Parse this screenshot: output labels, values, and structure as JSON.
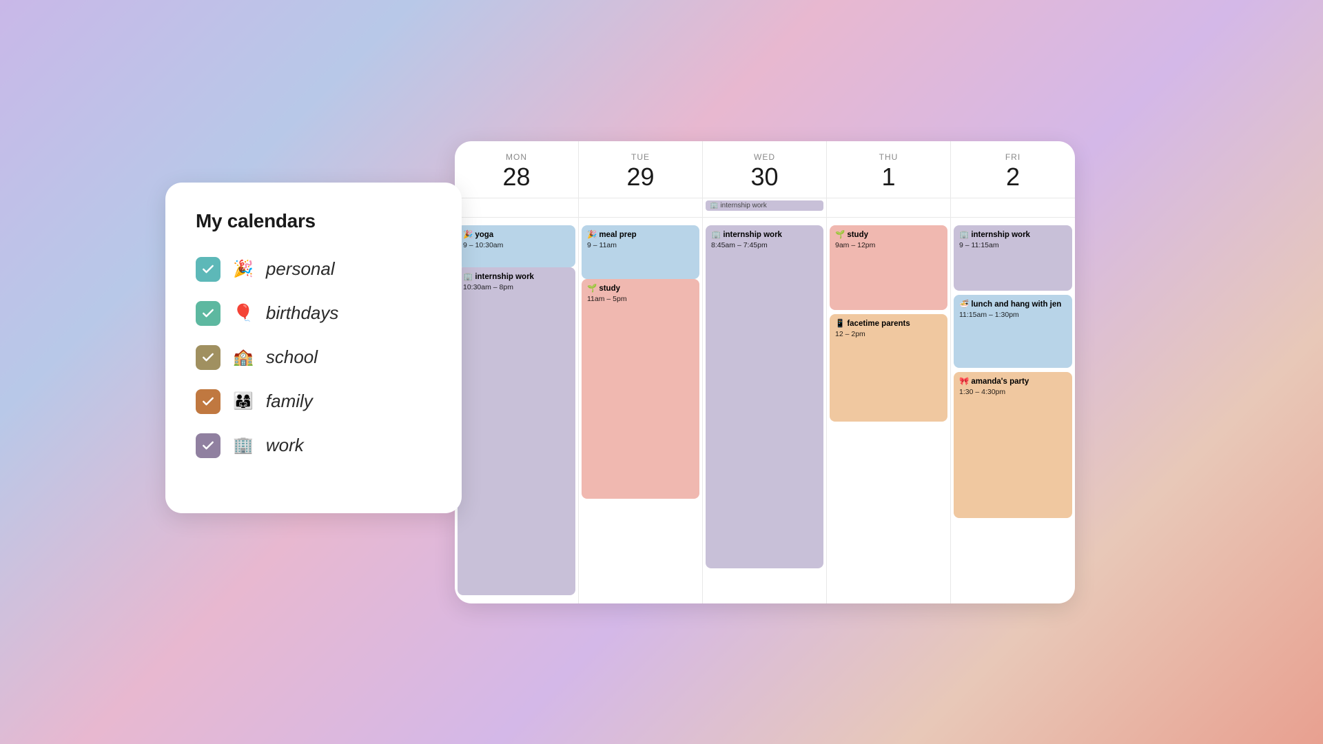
{
  "sidebar": {
    "title": "My calendars",
    "calendars": [
      {
        "id": "personal",
        "emoji": "🎉",
        "label": "personal",
        "color_class": "checkbox-personal",
        "checked": true
      },
      {
        "id": "birthdays",
        "emoji": "🎈",
        "label": "birthdays",
        "color_class": "checkbox-birthdays",
        "checked": true
      },
      {
        "id": "school",
        "emoji": "🏫",
        "label": "school",
        "color_class": "checkbox-school",
        "checked": true
      },
      {
        "id": "family",
        "emoji": "👨‍👩‍👧‍👦",
        "label": "family",
        "color_class": "checkbox-family",
        "checked": true
      },
      {
        "id": "work",
        "emoji": "🏢",
        "label": "work",
        "color_class": "checkbox-work",
        "checked": true
      }
    ]
  },
  "calendar": {
    "days": [
      {
        "name": "MON",
        "number": "28"
      },
      {
        "name": "TUE",
        "number": "29"
      },
      {
        "name": "WED",
        "number": "30"
      },
      {
        "name": "THU",
        "number": "1"
      },
      {
        "name": "FRI",
        "number": "2"
      }
    ],
    "all_day_events": [
      {
        "day": 2,
        "label": "internship work",
        "emoji": "🏢",
        "color_class": "event-work"
      }
    ],
    "events": {
      "mon": [
        {
          "id": "yoga",
          "emoji": "🎉",
          "title": "yoga",
          "time": "9 – 10:30am",
          "top_pct": 2,
          "height_pct": 11,
          "color_class": "event-personal"
        },
        {
          "id": "internship-work-mon",
          "emoji": "🏢",
          "title": "internship work",
          "time": "10:30am – 8pm",
          "top_pct": 13,
          "height_pct": 83,
          "color_class": "event-work"
        }
      ],
      "tue": [
        {
          "id": "meal-prep",
          "emoji": "🎉",
          "title": "meal prep",
          "time": "9 – 11am",
          "top_pct": 2,
          "height_pct": 15,
          "color_class": "event-personal"
        },
        {
          "id": "study-tue",
          "emoji": "🌱",
          "title": "study",
          "time": "11am – 5pm",
          "top_pct": 17,
          "height_pct": 55,
          "color_class": "event-study"
        }
      ],
      "wed": [
        {
          "id": "internship-work-wed",
          "emoji": "🏢",
          "title": "internship work",
          "time": "8:45am – 7:45pm",
          "top_pct": 2,
          "height_pct": 82,
          "color_class": "event-work"
        }
      ],
      "thu": [
        {
          "id": "study-thu",
          "emoji": "🌱",
          "title": "study",
          "time": "9am – 12pm",
          "top_pct": 2,
          "height_pct": 22,
          "color_class": "event-study"
        },
        {
          "id": "facetime-parents",
          "emoji": "📱",
          "title": "facetime parents",
          "time": "12 – 2pm",
          "top_pct": 26,
          "height_pct": 28,
          "color_class": "event-family"
        }
      ],
      "fri": [
        {
          "id": "internship-work-fri",
          "emoji": "🏢",
          "title": "internship work",
          "time": "9 – 11:15am",
          "top_pct": 2,
          "height_pct": 18,
          "color_class": "event-work"
        },
        {
          "id": "lunch-jen",
          "emoji": "🍜",
          "title": "lunch and hang with jen",
          "time": "11:15am – 1:30pm",
          "top_pct": 20,
          "height_pct": 20,
          "color_class": "event-personal"
        },
        {
          "id": "amandas-party",
          "emoji": "🎀",
          "title": "amanda's party",
          "time": "1:30 – 4:30pm",
          "top_pct": 40,
          "height_pct": 35,
          "color_class": "event-family"
        }
      ]
    }
  }
}
